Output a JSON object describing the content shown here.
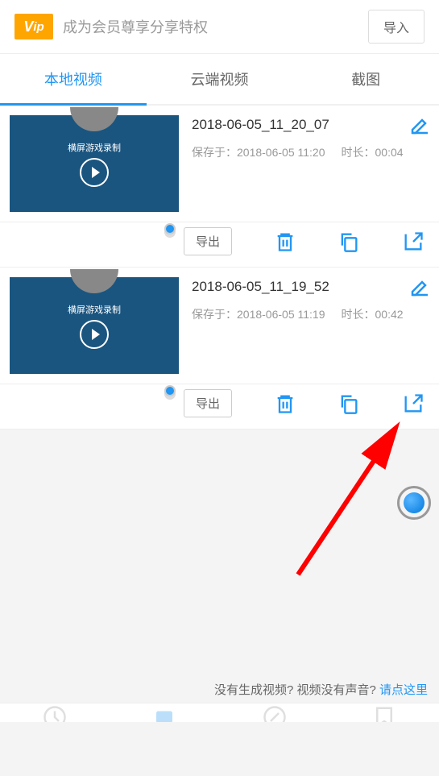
{
  "header": {
    "vip_text": "Vip",
    "subtitle": "成为会员尊享分享特权",
    "import_btn": "导入"
  },
  "tabs": [
    {
      "label": "本地视频",
      "active": true
    },
    {
      "label": "云端视频",
      "active": false
    },
    {
      "label": "截图",
      "active": false
    }
  ],
  "videos": [
    {
      "thumb_text": "横屏游戏录制",
      "title": "2018-06-05_11_20_07",
      "saved_at_label": "保存于：",
      "saved_at": "2018-06-05 11:20",
      "duration_label": "时长：",
      "duration": "00:04",
      "export_btn": "导出"
    },
    {
      "thumb_text": "横屏游戏录制",
      "title": "2018-06-05_11_19_52",
      "saved_at_label": "保存于：",
      "saved_at": "2018-06-05 11:19",
      "duration_label": "时长：",
      "duration": "00:42",
      "export_btn": "导出"
    }
  ],
  "footer": {
    "question": "没有生成视频? 视频没有声音? ",
    "link": "请点这里"
  },
  "colors": {
    "primary": "#2196f3"
  }
}
